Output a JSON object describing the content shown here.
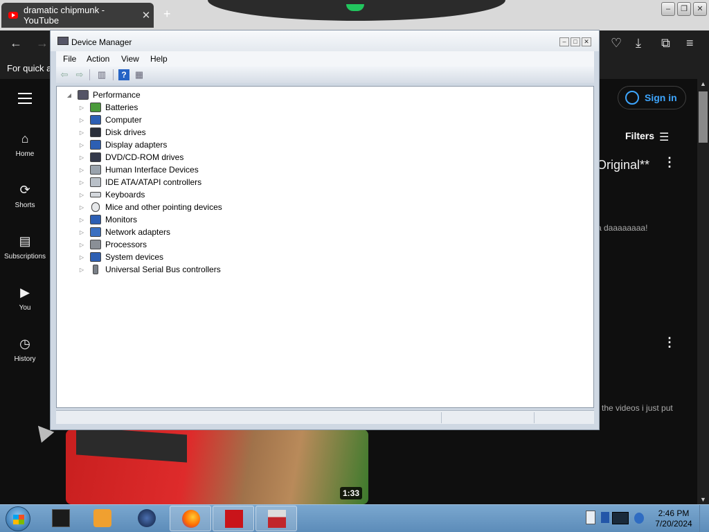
{
  "browser": {
    "tab_title": "dramatic chipmunk - YouTube",
    "tab_close": "✕",
    "new_tab": "+",
    "bookmarks_text": "For quick ac"
  },
  "youtube": {
    "sidebar": [
      {
        "label": "Home"
      },
      {
        "label": "Shorts"
      },
      {
        "label": "Subscriptions"
      },
      {
        "label": "You"
      },
      {
        "label": "History"
      }
    ],
    "sign_in": "Sign in",
    "filters": "Filters",
    "video_title_fragment": "Original**",
    "description_fragment_1": "a daaaaaaaa!",
    "description_fragment_2": "the videos i just put",
    "duration": "1:33"
  },
  "device_manager": {
    "title": "Device Manager",
    "menu": [
      "File",
      "Action",
      "View",
      "Help"
    ],
    "root": "Performance",
    "nodes": [
      "Batteries",
      "Computer",
      "Disk drives",
      "Display adapters",
      "DVD/CD-ROM drives",
      "Human Interface Devices",
      "IDE ATA/ATAPI controllers",
      "Keyboards",
      "Mice and other pointing devices",
      "Monitors",
      "Network adapters",
      "Processors",
      "System devices",
      "Universal Serial Bus controllers"
    ]
  },
  "taskbar": {
    "time": "2:46 PM",
    "date": "7/20/2024"
  }
}
